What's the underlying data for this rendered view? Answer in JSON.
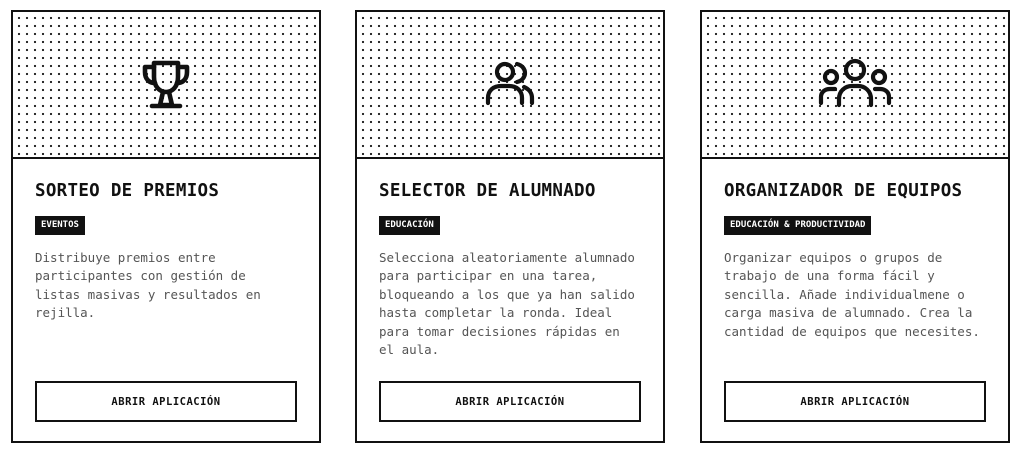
{
  "colors": {
    "ink": "#111111",
    "paper": "#ffffff",
    "muted_text": "#555555"
  },
  "cards": [
    {
      "icon": "trophy-icon",
      "title": "SORTEO DE PREMIOS",
      "tag": "EVENTOS",
      "description": "Distribuye premios entre participantes con gestión de listas masivas y resultados en rejilla.",
      "button_label": "ABRIR APLICACIÓN"
    },
    {
      "icon": "users-icon",
      "title": "SELECTOR DE ALUMNADO",
      "tag": "EDUCACIÓN",
      "description": "Selecciona aleatoriamente alumnado para participar en una tarea, bloqueando a los que ya han salido hasta completar la ronda. Ideal para tomar decisiones rápidas en el aula.",
      "button_label": "ABRIR APLICACIÓN"
    },
    {
      "icon": "user-group-icon",
      "title": "ORGANIZADOR DE EQUIPOS",
      "tag": "EDUCACIÓN & PRODUCTIVIDAD",
      "description": "Organizar equipos o grupos de trabajo de una forma fácil y sencilla. Añade individualmene o carga masiva de alumnado. Crea la cantidad de equipos que necesites.",
      "button_label": "ABRIR APLICACIÓN"
    }
  ]
}
